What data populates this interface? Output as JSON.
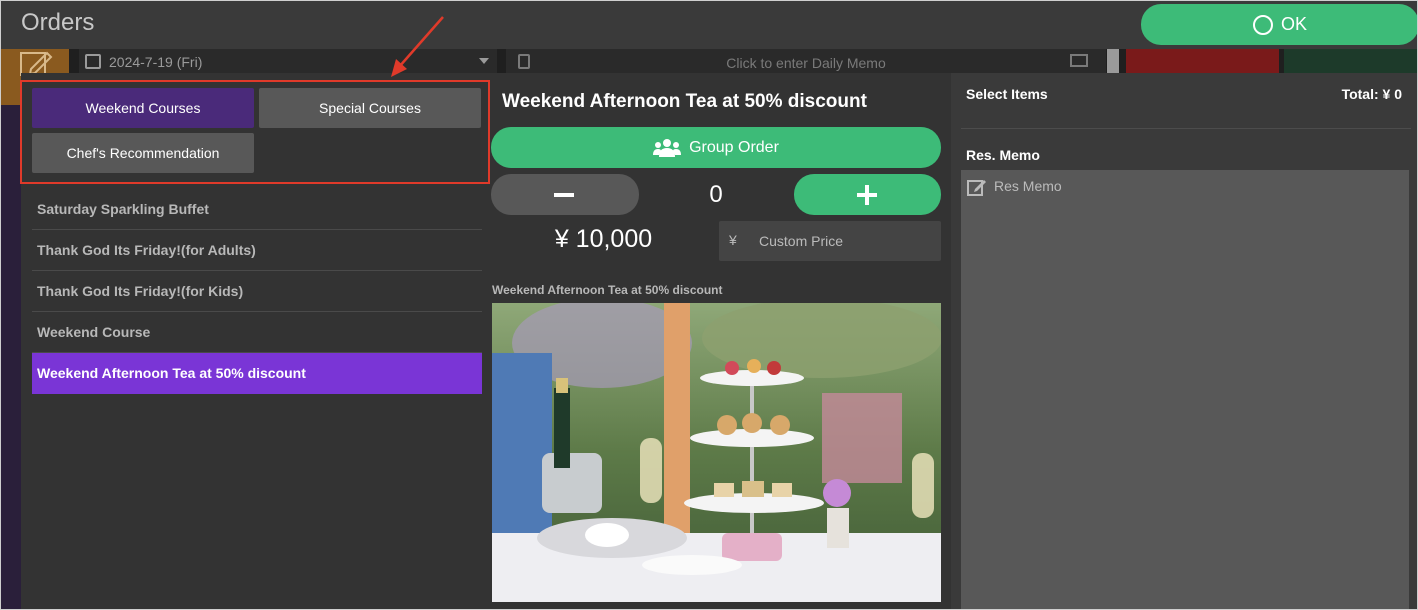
{
  "header": {
    "title": "Orders",
    "ok_label": "OK"
  },
  "background": {
    "date": "2024-7-19 (Fri)",
    "memo_placeholder": "Click to enter Daily Memo"
  },
  "categories": [
    {
      "label": "Weekend Courses",
      "active": true
    },
    {
      "label": "Special Courses",
      "active": false
    },
    {
      "label": "Chef's Recommendation",
      "active": false
    }
  ],
  "courses": [
    {
      "label": "Saturday Sparkling Buffet"
    },
    {
      "label": "Thank God Its Friday!(for Adults)"
    },
    {
      "label": "Thank God Its Friday!(for Kids)"
    },
    {
      "label": "Weekend Course"
    },
    {
      "label": "Weekend Afternoon Tea at 50% discount",
      "selected": true
    }
  ],
  "detail": {
    "title": "Weekend Afternoon Tea at 50% discount",
    "group_order_label": "Group Order",
    "quantity": "0",
    "price": "¥ 10,000",
    "currency_symbol": "¥",
    "custom_price_placeholder": "Custom Price",
    "image_caption": "Weekend Afternoon Tea at 50% discount"
  },
  "summary": {
    "select_items_label": "Select Items",
    "total": "Total: ¥ 0",
    "res_memo_label": "Res. Memo",
    "res_memo_placeholder": "Res Memo"
  },
  "colors": {
    "accent_green": "#3dbb78",
    "selected_purple": "#7a35d6",
    "active_category": "#4a2a7a",
    "annotation_red": "#e03a2a"
  }
}
